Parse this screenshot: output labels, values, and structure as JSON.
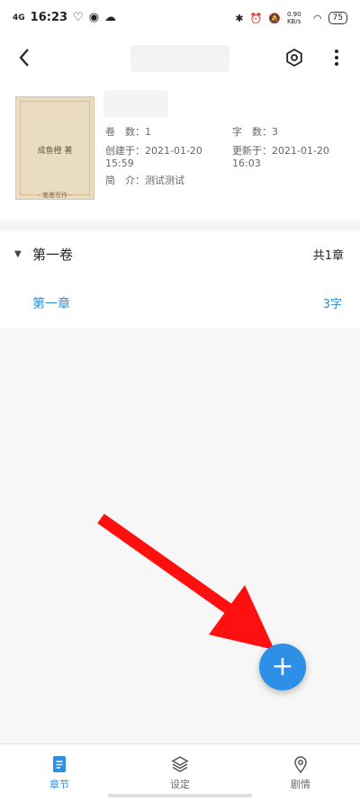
{
  "status_bar": {
    "network": "4G",
    "time": "16:23",
    "speed": "0.90 KB/s",
    "battery": "75"
  },
  "book": {
    "cover_title": "成鱼橙 著",
    "cover_brand": "- 笔墨写作 -",
    "meta": {
      "volumes_label": "卷　数：",
      "volumes_value": "1",
      "words_label": "字　数：",
      "words_value": "3",
      "created_label": "创建于：",
      "created_value_1": "2021-01-20",
      "created_value_2": "15:59",
      "updated_label": "更新于：",
      "updated_value_1": "2021-01-20",
      "updated_value_2": "16:03",
      "intro_label": "简　介：",
      "intro_value": "测试测试"
    }
  },
  "volume": {
    "title": "第一卷",
    "count": "共1章",
    "chapters": [
      {
        "title": "第一章",
        "words": "3字"
      }
    ]
  },
  "fab": {
    "label": "+"
  },
  "bottom_nav": {
    "items": [
      {
        "label": "章节",
        "icon": "chapter-icon",
        "active": true
      },
      {
        "label": "设定",
        "icon": "layers-icon",
        "active": false
      },
      {
        "label": "剧情",
        "icon": "location-pin-icon",
        "active": false
      }
    ]
  },
  "colors": {
    "accent": "#2d8fe6",
    "arrow": "#ff1010"
  }
}
